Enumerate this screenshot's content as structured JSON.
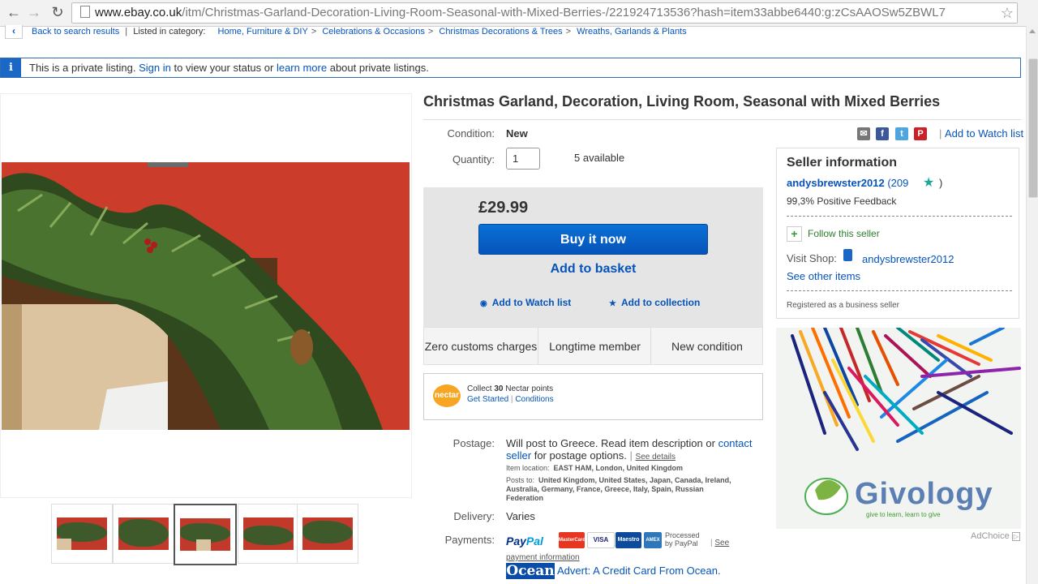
{
  "browser": {
    "url_host": "www.ebay.co.uk",
    "url_path": "/itm/Christmas-Garland-Decoration-Living-Room-Seasonal-with-Mixed-Berries-/221924713536?hash=item33abbe6440:g:zCsAAOSw5ZBWL7",
    "back_icon": "arrow-left-icon",
    "forward_icon": "arrow-right-icon",
    "reload_icon": "reload-icon",
    "bookmark_icon": "star-icon"
  },
  "breadcrumb": {
    "back_label": "Back to search results",
    "listed_in": "Listed in category:",
    "items": [
      "Home, Furniture & DIY",
      "Celebrations & Occasions",
      "Christmas Decorations & Trees",
      "Wreaths, Garlands & Plants"
    ]
  },
  "banner": {
    "text_pre": "This is a private listing.",
    "sign_in": "Sign in",
    "text_mid": "to view your status or",
    "learn_more": "learn more",
    "text_post": "about private listings."
  },
  "item": {
    "title": "Christmas Garland, Decoration, Living Room, Seasonal with Mixed Berries",
    "condition_label": "Condition:",
    "condition_value": "New",
    "quantity_label": "Quantity:",
    "quantity_value": "1",
    "available": "5 available",
    "price": "£29.99",
    "buy_now": "Buy it now",
    "add_basket": "Add to basket",
    "add_watch": "Add to Watch list",
    "add_collection": "Add to collection",
    "watch_top": "Add to Watch list"
  },
  "features": [
    "Zero customs charges",
    "Longtime member",
    "New condition"
  ],
  "nectar": {
    "logo": "nectar",
    "collect_pre": "Collect",
    "points": "30",
    "collect_post": "Nectar points",
    "get_started": "Get Started",
    "conditions": "Conditions"
  },
  "postage": {
    "label": "Postage:",
    "text1": "Will post to Greece. Read item description or",
    "contact": "contact seller",
    "text2": "for postage options.",
    "see_details": "See details",
    "location_label": "Item location:",
    "location": "EAST HAM, London, United Kingdom",
    "posts_label": "Posts to:",
    "posts": "United Kingdom, United States, Japan, Canada, Ireland, Australia, Germany, France, Greece, Italy, Spain, Russian Federation"
  },
  "delivery": {
    "label": "Delivery:",
    "value": "Varies"
  },
  "payments": {
    "label": "Payments:",
    "paypal_a": "Pay",
    "paypal_b": "Pal",
    "cards": [
      "MasterCard",
      "VISA",
      "Maestro",
      "AMEX"
    ],
    "processed": "Processed by PayPal",
    "see": "See",
    "payment_info": "payment information"
  },
  "ocean": {
    "logo": "Ocean",
    "text": "Advert: A Credit Card From Ocean."
  },
  "seller": {
    "heading": "Seller information",
    "name": "andysbrewster2012",
    "score": "(209",
    "score_close": ")",
    "feedback": "99,3% Positive Feedback",
    "follow": "Follow this seller",
    "visit_shop": "Visit Shop:",
    "shop_name": "andysbrewster2012",
    "see_other": "See other items",
    "registered": "Registered as a business seller"
  },
  "ad": {
    "brand": "Givology",
    "tagline": "give to learn, learn to give",
    "adchoice": "AdChoice"
  },
  "colors": {
    "ebay_blue": "#0654ba",
    "buy_button": "#0654ba",
    "price_box": "#e5e5e5"
  }
}
